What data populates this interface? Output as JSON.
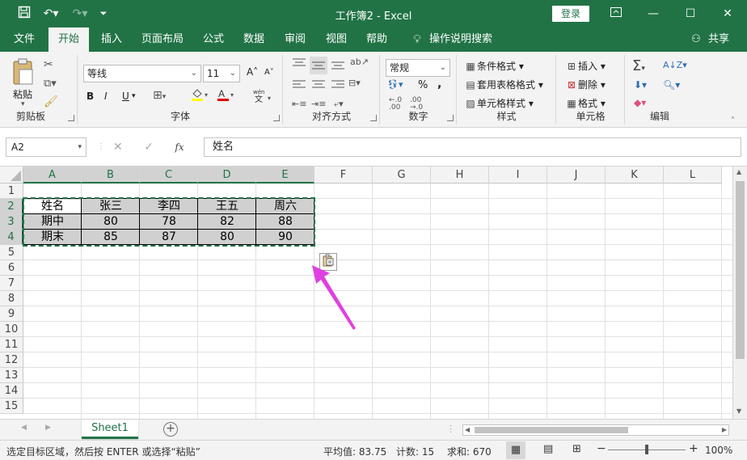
{
  "titlebar": {
    "title": "工作簿2  -  Excel",
    "login": "登录"
  },
  "menu": {
    "tabs": [
      "文件",
      "开始",
      "插入",
      "页面布局",
      "公式",
      "数据",
      "审阅",
      "视图",
      "帮助"
    ],
    "search": "操作说明搜索",
    "share": "共享"
  },
  "ribbon": {
    "paste": "粘贴",
    "clipboard": "剪贴板",
    "font_name": "等线",
    "font_size": "11",
    "bold": "B",
    "italic": "I",
    "underline": "U",
    "font_group": "字体",
    "align_group": "对齐方式",
    "number_format": "常规",
    "number_group": "数字",
    "conditional": "条件格式",
    "table_format": "套用表格格式",
    "cell_style": "单元格样式",
    "style_group": "样式",
    "insert": "插入",
    "delete": "删除",
    "format": "格式",
    "cells_group": "单元格",
    "edit_group": "编辑",
    "percent": "%",
    "comma": ","
  },
  "formula": {
    "namebox": "A2",
    "fx": "fx",
    "value": "姓名"
  },
  "grid": {
    "columns": [
      "A",
      "B",
      "C",
      "D",
      "E",
      "F",
      "G",
      "H",
      "I",
      "J",
      "K",
      "L"
    ],
    "rows": [
      "1",
      "2",
      "3",
      "4",
      "5",
      "6",
      "7",
      "8",
      "9",
      "10",
      "11",
      "12",
      "13",
      "14",
      "15"
    ],
    "data": [
      [
        "姓名",
        "张三",
        "李四",
        "王五",
        "周六"
      ],
      [
        "期中",
        "80",
        "78",
        "82",
        "88"
      ],
      [
        "期末",
        "85",
        "87",
        "80",
        "90"
      ]
    ]
  },
  "sheets": {
    "active": "Sheet1"
  },
  "status": {
    "message": "选定目标区域，然后按 ENTER 或选择“粘贴”",
    "average": "平均值: 83.75",
    "count": "计数: 15",
    "sum": "求和: 670",
    "zoom": "100%"
  },
  "colors": {
    "accent": "#217346",
    "selection_fill": "#d0d0d0",
    "arrow": "#e040e0"
  }
}
